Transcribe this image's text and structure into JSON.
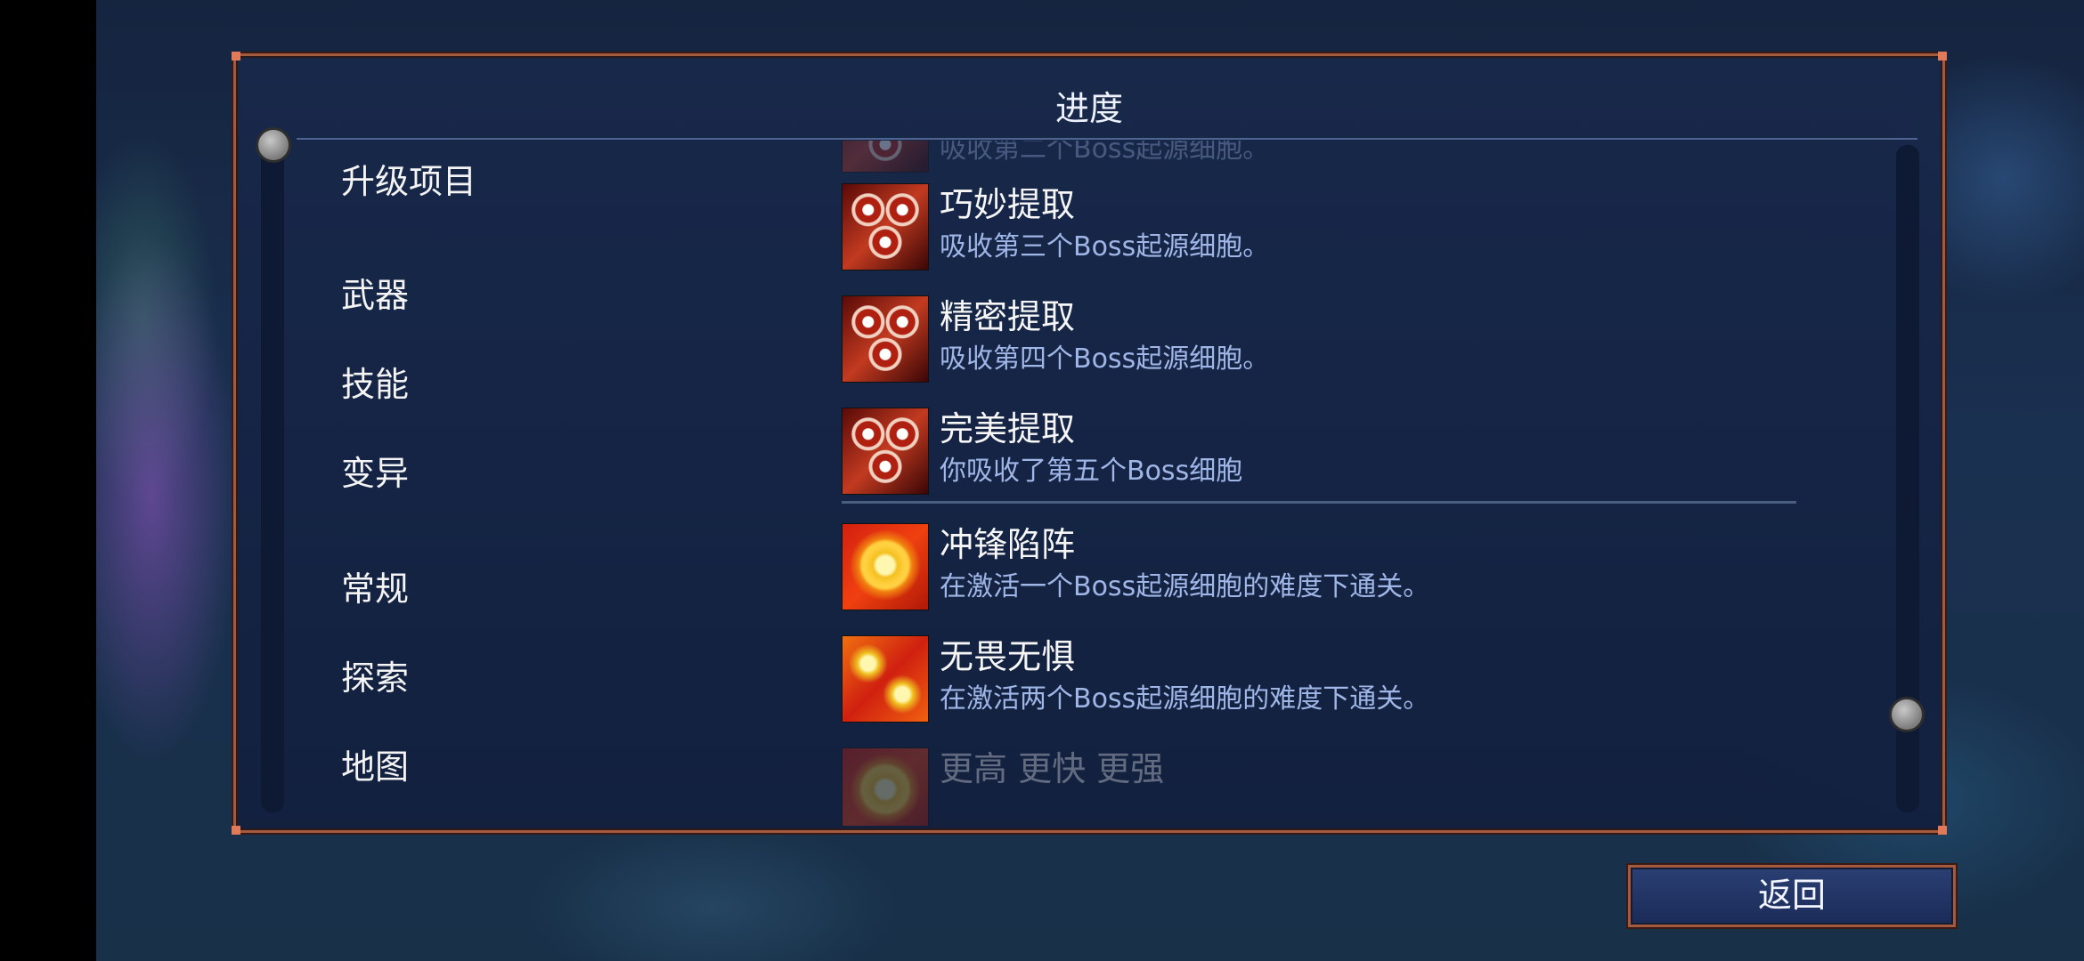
{
  "panel": {
    "title": "进度"
  },
  "categories": [
    {
      "label": "升级项目"
    },
    {
      "label": "武器"
    },
    {
      "label": "技能"
    },
    {
      "label": "变异"
    },
    {
      "label": "常规"
    },
    {
      "label": "探索"
    },
    {
      "label": "地图"
    }
  ],
  "achievements": {
    "partial_top": {
      "desc": "吸收第二个Boss起源细胞。"
    },
    "items": [
      {
        "title": "巧妙提取",
        "desc": "吸收第三个Boss起源细胞。",
        "icon": "boss-cell-gears-3-icon"
      },
      {
        "title": "精密提取",
        "desc": "吸收第四个Boss起源细胞。",
        "icon": "boss-cell-gears-4-icon"
      },
      {
        "title": "完美提取",
        "desc": "你吸收了第五个Boss细胞",
        "icon": "boss-cell-gears-5-icon"
      },
      {
        "title": "冲锋陷阵",
        "desc": "在激活一个Boss起源细胞的难度下通关。",
        "icon": "boss-cell-flame-1-icon"
      },
      {
        "title": "无畏无惧",
        "desc": "在激活两个Boss起源细胞的难度下通关。",
        "icon": "boss-cell-flame-2-icon"
      }
    ],
    "partial_bottom": {
      "title": "更高 更快 更强"
    }
  },
  "buttons": {
    "back_label": "返回"
  }
}
